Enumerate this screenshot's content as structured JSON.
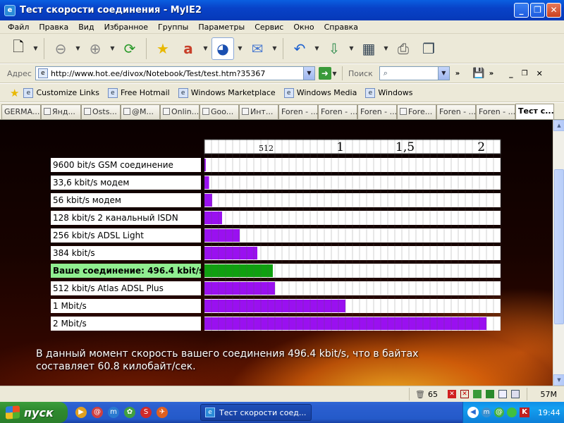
{
  "window": {
    "title": "Тест скорости соединения - MyIE2"
  },
  "menu": [
    "Файл",
    "Правка",
    "Вид",
    "Избранное",
    "Группы",
    "Параметры",
    "Сервис",
    "Окно",
    "Справка"
  ],
  "address": {
    "label": "Адрес",
    "url": "http://www.hot.ee/divox/Notebook/Test/test.htm?35367"
  },
  "search": {
    "label": "Поиск",
    "value": ""
  },
  "links": [
    "Customize Links",
    "Free Hotmail",
    "Windows Marketplace",
    "Windows Media",
    "Windows"
  ],
  "tabs": [
    "GERMA...",
    "Янд...",
    "Osts...",
    "@M...",
    "Onlin...",
    "Goo...",
    "Инт...",
    "Foren - ...",
    "Foren - ...",
    "Foren - ...",
    "Fore...",
    "Foren - ...",
    "Foren - ...",
    "Тест с..."
  ],
  "chart_data": {
    "type": "bar",
    "axis_ticks": [
      "512",
      "1",
      "1,5",
      "2"
    ],
    "categories": [
      "9600 bit/s GSM соединение",
      "33,6 kbit/s модем",
      "56 kbit/s модем",
      "128 kbit/s 2 канальный ISDN",
      "256 kbit/s ADSL Light",
      "384 kbit/s",
      "Ваше соединение: 496.4 kbit/s",
      "512 kbit/s Atlas ADSL Plus",
      "1 Mbit/s",
      "2 Mbit/s"
    ],
    "values": [
      9.6,
      33.6,
      56,
      128,
      256,
      384,
      496.4,
      512,
      1024,
      2048
    ],
    "highlight_index": 6,
    "xlim": [
      0,
      2150
    ],
    "colors": {
      "bar": "#9a10f0",
      "highlight": "#10a010",
      "highlight_label_bg": "#90ee90"
    }
  },
  "result": {
    "line1": "В данный момент скорость вашего соединения 496.4 kbit/s, что в байтах",
    "line2": "составляет 60.8 килобайт/сек."
  },
  "status": {
    "count": "65",
    "memory": "57M"
  },
  "taskbar": {
    "start": "пуск",
    "item": "Тест скорости соед...",
    "time": "19:44"
  }
}
